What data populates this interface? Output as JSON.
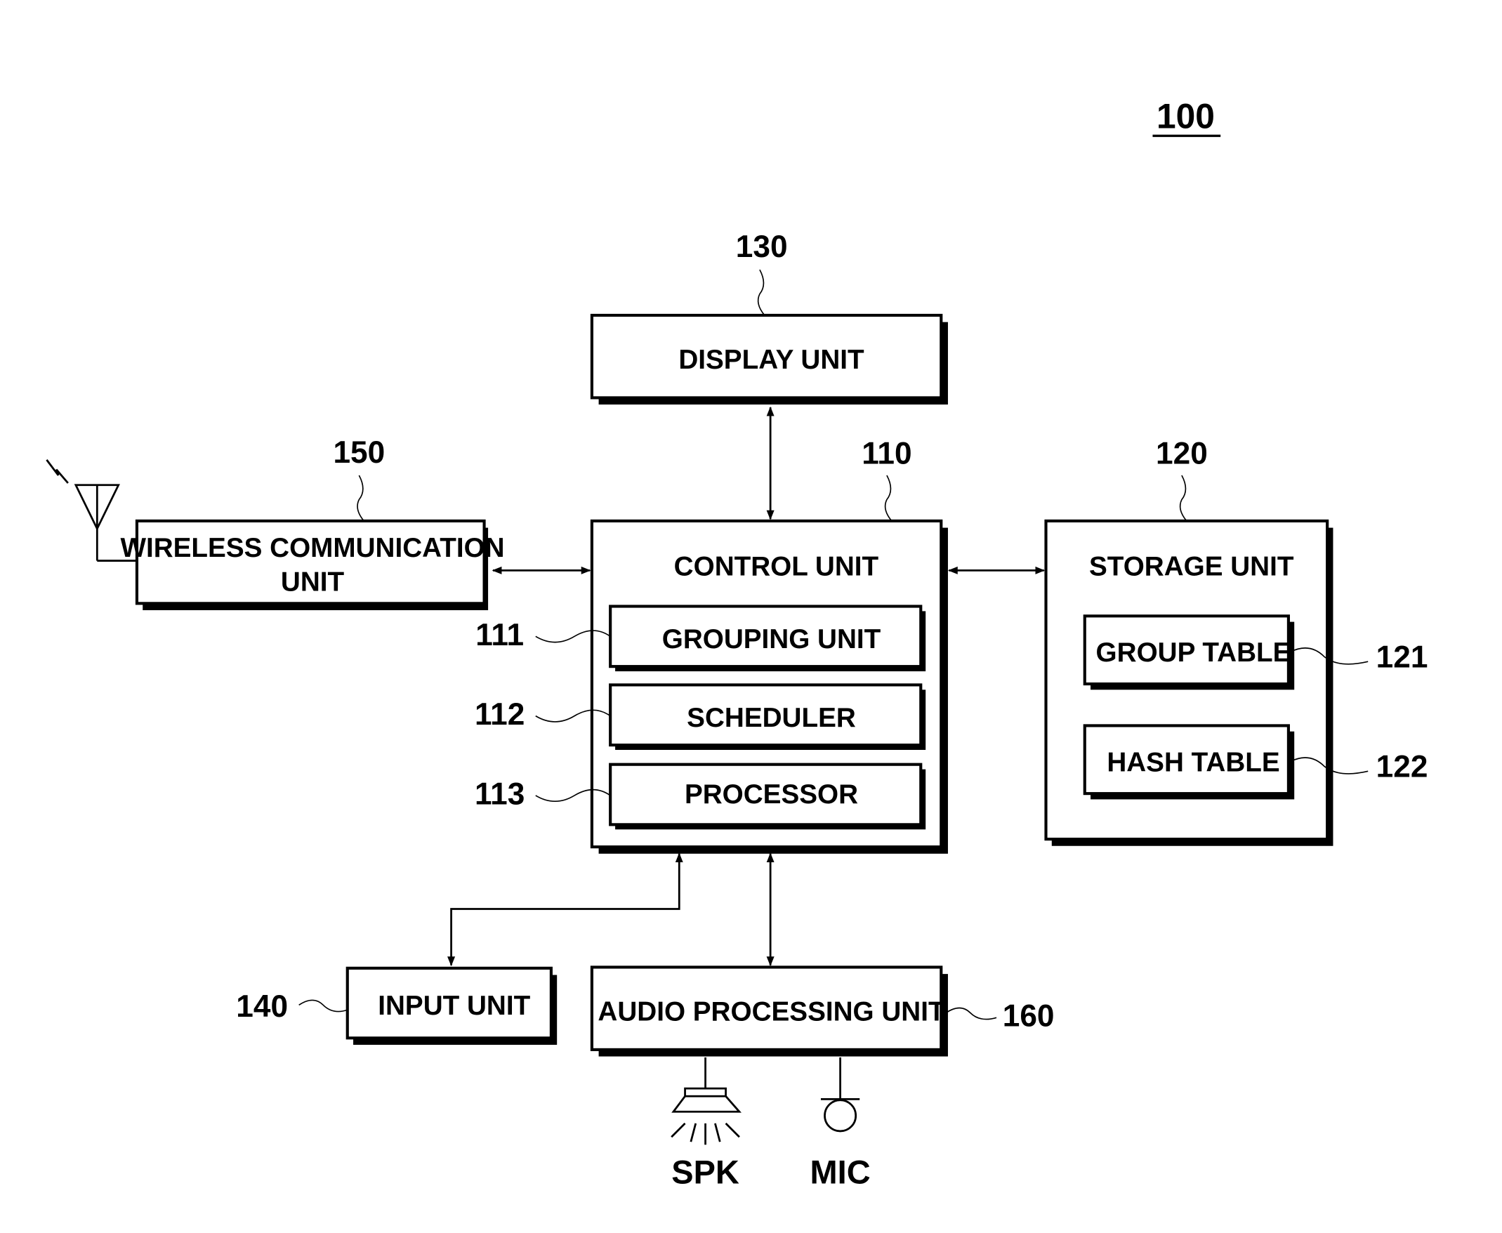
{
  "figure_ref": "100",
  "blocks": {
    "display": {
      "ref": "130",
      "label": "DISPLAY UNIT"
    },
    "wireless": {
      "ref": "150",
      "label_line1": "WIRELESS COMMUNICATION",
      "label_line2": "UNIT"
    },
    "control": {
      "ref": "110",
      "label": "CONTROL UNIT"
    },
    "grouping": {
      "ref": "111",
      "label": "GROUPING UNIT"
    },
    "scheduler": {
      "ref": "112",
      "label": "SCHEDULER"
    },
    "processor": {
      "ref": "113",
      "label": "PROCESSOR"
    },
    "storage": {
      "ref": "120",
      "label": "STORAGE UNIT"
    },
    "group_table": {
      "ref": "121",
      "label": "GROUP TABLE"
    },
    "hash_table": {
      "ref": "122",
      "label": "HASH TABLE"
    },
    "input": {
      "ref": "140",
      "label": "INPUT UNIT"
    },
    "audio": {
      "ref": "160",
      "label": "AUDIO PROCESSING UNIT"
    }
  },
  "peripherals": {
    "speaker": "SPK",
    "microphone": "MIC"
  }
}
